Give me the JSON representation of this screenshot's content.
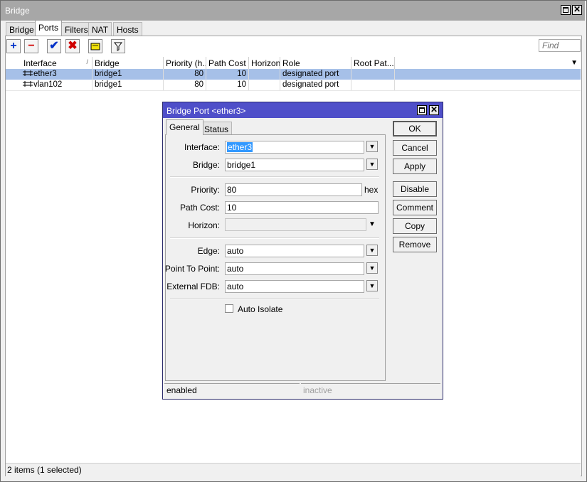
{
  "window": {
    "title": "Bridge"
  },
  "tabs": [
    "Bridge",
    "Ports",
    "Filters",
    "NAT",
    "Hosts"
  ],
  "toolbar": {
    "find_placeholder": "Find"
  },
  "table": {
    "columns": [
      "Interface",
      "Bridge",
      "Priority (h...",
      "Path Cost",
      "Horizon",
      "Role",
      "Root Pat..."
    ],
    "rows": [
      {
        "interface": "ether3",
        "bridge": "bridge1",
        "priority": "80",
        "path_cost": "10",
        "horizon": "",
        "role": "designated port",
        "root_path": ""
      },
      {
        "interface": "vlan102",
        "bridge": "bridge1",
        "priority": "80",
        "path_cost": "10",
        "horizon": "",
        "role": "designated port",
        "root_path": ""
      }
    ]
  },
  "status": {
    "text": "2 items (1 selected)"
  },
  "dialog": {
    "title": "Bridge Port <ether3>",
    "tabs": [
      "General",
      "Status"
    ],
    "labels": {
      "interface": "Interface:",
      "bridge": "Bridge:",
      "priority": "Priority:",
      "path_cost": "Path Cost:",
      "horizon": "Horizon:",
      "edge": "Edge:",
      "point_to_point": "Point To Point:",
      "external_fdb": "External FDB:",
      "auto_isolate": "Auto Isolate",
      "hex": "hex"
    },
    "values": {
      "interface": "ether3",
      "bridge": "bridge1",
      "priority": "80",
      "path_cost": "10",
      "horizon": "",
      "edge": "auto",
      "point_to_point": "auto",
      "external_fdb": "auto",
      "auto_isolate": false
    },
    "buttons": [
      "OK",
      "Cancel",
      "Apply",
      "Disable",
      "Comment",
      "Copy",
      "Remove"
    ],
    "status": {
      "left": "enabled",
      "right": "inactive"
    }
  }
}
